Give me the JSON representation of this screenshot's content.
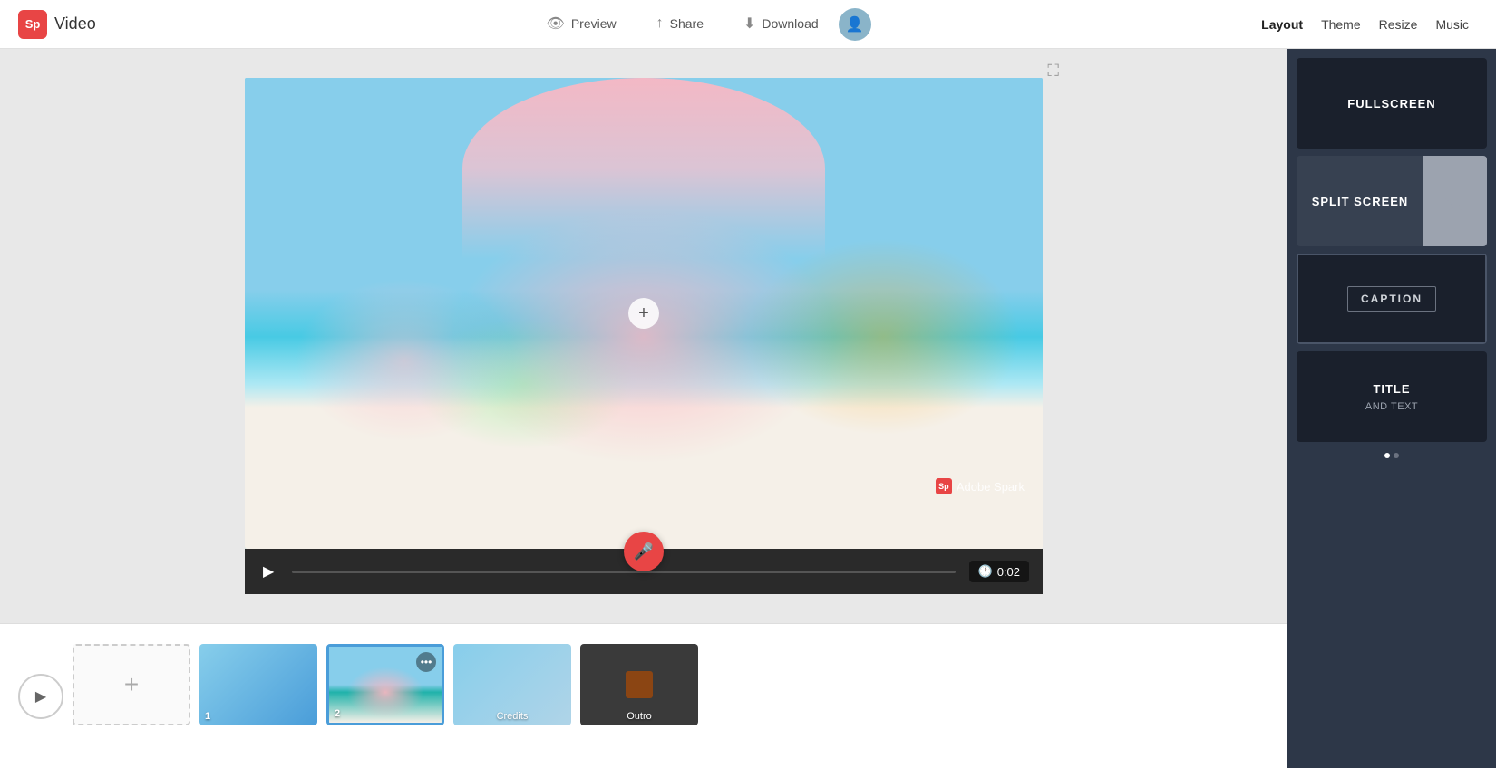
{
  "brand": {
    "logo_text": "Sp",
    "title": "Video"
  },
  "nav": {
    "preview_label": "Preview",
    "share_label": "Share",
    "download_label": "Download",
    "layout_label": "Layout",
    "theme_label": "Theme",
    "resize_label": "Resize",
    "music_label": "Music"
  },
  "player": {
    "watermark_text": "Adobe Spark",
    "watermark_logo": "Sp",
    "time": "0:02",
    "add_icon": "+"
  },
  "timeline": {
    "items": [
      {
        "id": "1",
        "type": "blue",
        "number": "1",
        "label": ""
      },
      {
        "id": "2",
        "type": "flower",
        "number": "2",
        "label": "",
        "has_dots": true
      },
      {
        "id": "3",
        "type": "blue2",
        "number": "",
        "label": "Credits"
      },
      {
        "id": "4",
        "type": "outro",
        "number": "",
        "label": "Outro"
      }
    ]
  },
  "layout_panel": {
    "fullscreen_label": "FULLSCREEN",
    "split_screen_label": "SPLIT\nSCREEN",
    "caption_label": "CAPTION",
    "title_label": "TITLE",
    "title_sublabel": "AND TEXT"
  }
}
